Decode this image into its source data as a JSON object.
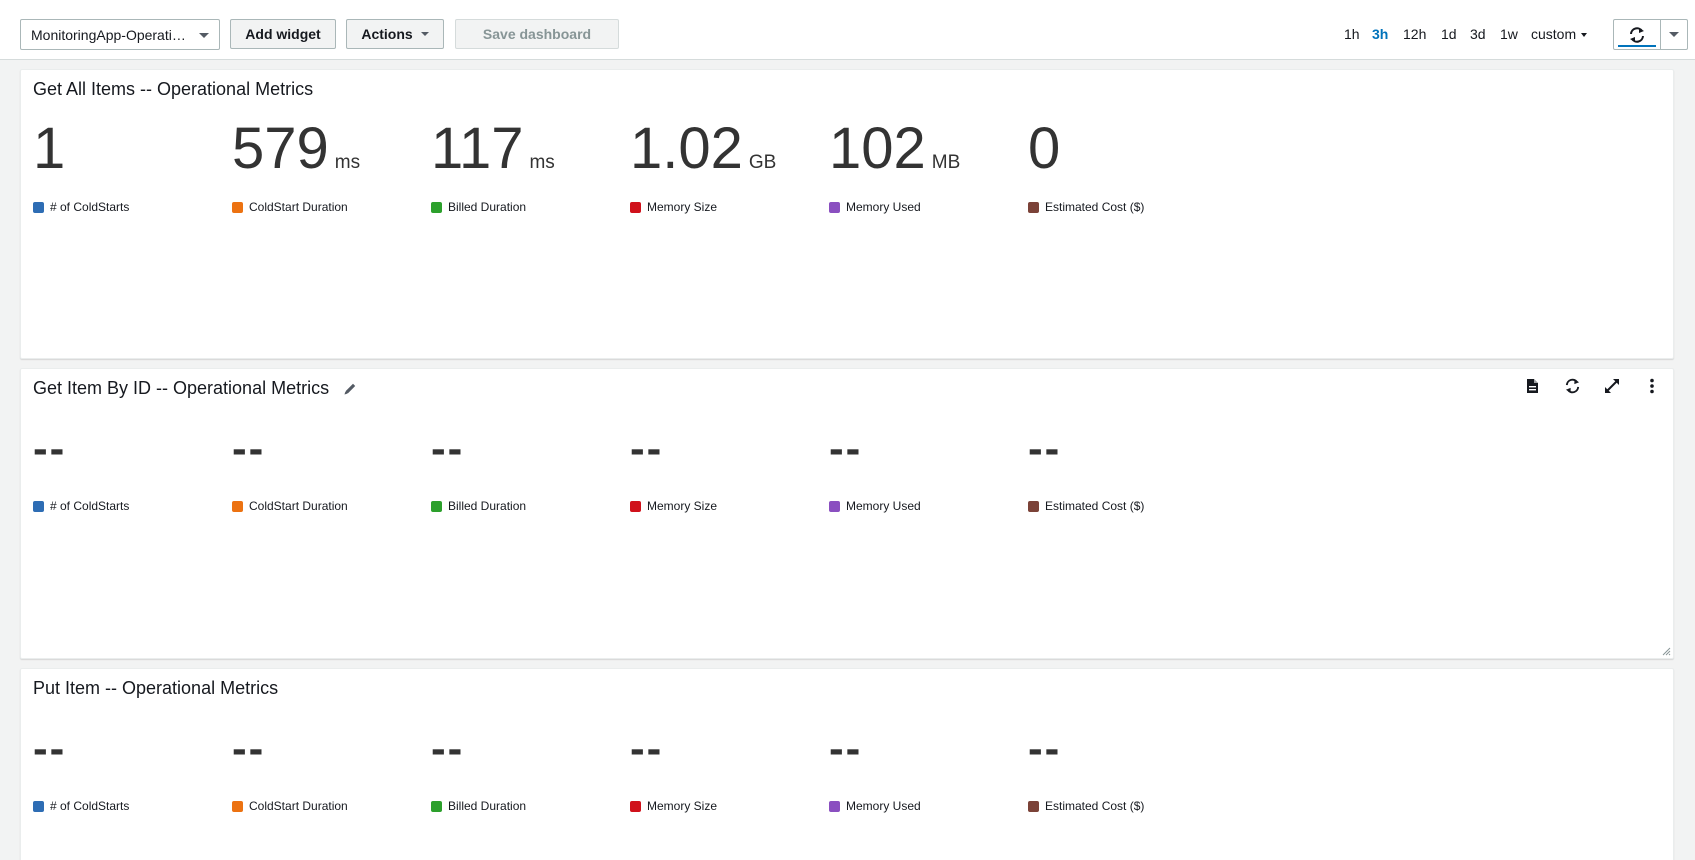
{
  "toolbar": {
    "dashboard_name": "MonitoringApp-Operati…",
    "add_widget": "Add widget",
    "actions": "Actions",
    "save_dashboard": "Save dashboard",
    "time_ranges": [
      "1h",
      "3h",
      "12h",
      "1d",
      "3d",
      "1w",
      "custom"
    ],
    "active_range": "3h"
  },
  "colors": {
    "coldstarts": "#2e6db4",
    "coldstart_duration": "#ec7211",
    "billed_duration": "#2ca02c",
    "memory_size": "#d0111b",
    "memory_used": "#8a4fc0",
    "estimated_cost": "#7b4238",
    "accent": "#0073bb"
  },
  "widgets": [
    {
      "title": "Get All Items -- Operational Metrics",
      "metrics": [
        {
          "value": "1",
          "unit": "",
          "label": "# of ColdStarts"
        },
        {
          "value": "579",
          "unit": "ms",
          "label": "ColdStart Duration"
        },
        {
          "value": "117",
          "unit": "ms",
          "label": "Billed Duration"
        },
        {
          "value": "1.02",
          "unit": "GB",
          "label": "Memory Size"
        },
        {
          "value": "102",
          "unit": "MB",
          "label": "Memory Used"
        },
        {
          "value": "0",
          "unit": "",
          "label": "Estimated Cost ($)"
        }
      ]
    },
    {
      "title": "Get Item By ID -- Operational Metrics",
      "tools": [
        "document-icon",
        "refresh-icon",
        "expand-icon",
        "more-icon"
      ],
      "metrics": [
        {
          "value": "--",
          "unit": "",
          "label": "# of ColdStarts"
        },
        {
          "value": "--",
          "unit": "",
          "label": "ColdStart Duration"
        },
        {
          "value": "--",
          "unit": "",
          "label": "Billed Duration"
        },
        {
          "value": "--",
          "unit": "",
          "label": "Memory Size"
        },
        {
          "value": "--",
          "unit": "",
          "label": "Memory Used"
        },
        {
          "value": "--",
          "unit": "",
          "label": "Estimated Cost ($)"
        }
      ]
    },
    {
      "title": "Put Item -- Operational Metrics",
      "metrics": [
        {
          "value": "--",
          "unit": "",
          "label": "# of ColdStarts"
        },
        {
          "value": "--",
          "unit": "",
          "label": "ColdStart Duration"
        },
        {
          "value": "--",
          "unit": "",
          "label": "Billed Duration"
        },
        {
          "value": "--",
          "unit": "",
          "label": "Memory Size"
        },
        {
          "value": "--",
          "unit": "",
          "label": "Memory Used"
        },
        {
          "value": "--",
          "unit": "",
          "label": "Estimated Cost ($)"
        }
      ]
    }
  ]
}
